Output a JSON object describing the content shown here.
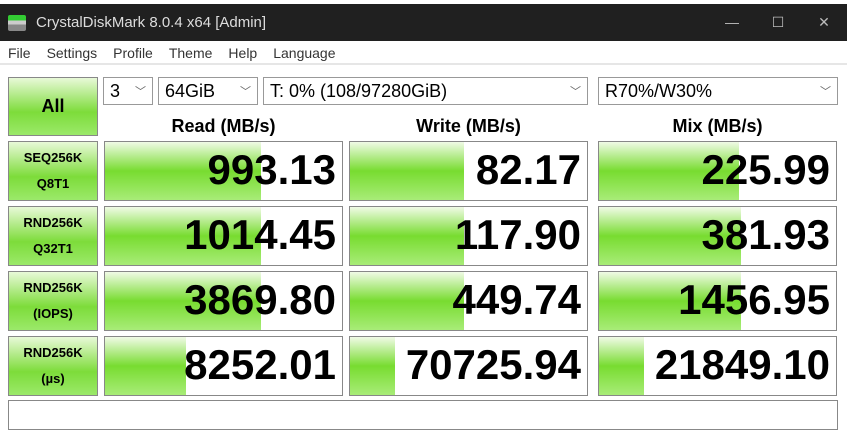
{
  "window": {
    "title": "CrystalDiskMark 8.0.4 x64 [Admin]",
    "minimize": "—",
    "maximize": "☐",
    "close": "✕"
  },
  "menu": [
    "File",
    "Settings",
    "Profile",
    "Theme",
    "Help",
    "Language"
  ],
  "controls": {
    "all_label": "All",
    "count": "3",
    "size": "64GiB",
    "drive": "T: 0% (108/97280GiB)",
    "mix": "R70%/W30%"
  },
  "columns": [
    "Read (MB/s)",
    "Write (MB/s)",
    "Mix (MB/s)"
  ],
  "rows": [
    {
      "line1": "SEQ256K",
      "line2": "Q8T1",
      "values": [
        "993.13",
        "82.17",
        "225.99"
      ],
      "fill": [
        0.66,
        0.48,
        0.59
      ]
    },
    {
      "line1": "RND256K",
      "line2": "Q32T1",
      "values": [
        "1014.45",
        "117.90",
        "381.93"
      ],
      "fill": [
        0.66,
        0.48,
        0.6
      ]
    },
    {
      "line1": "RND256K",
      "line2": "(IOPS)",
      "values": [
        "3869.80",
        "449.74",
        "1456.95"
      ],
      "fill": [
        0.66,
        0.48,
        0.6
      ]
    },
    {
      "line1": "RND256K",
      "line2": "(µs)",
      "values": [
        "8252.01",
        "70725.94",
        "21849.10"
      ],
      "fill": [
        0.34,
        0.19,
        0.19
      ]
    }
  ],
  "status": ""
}
